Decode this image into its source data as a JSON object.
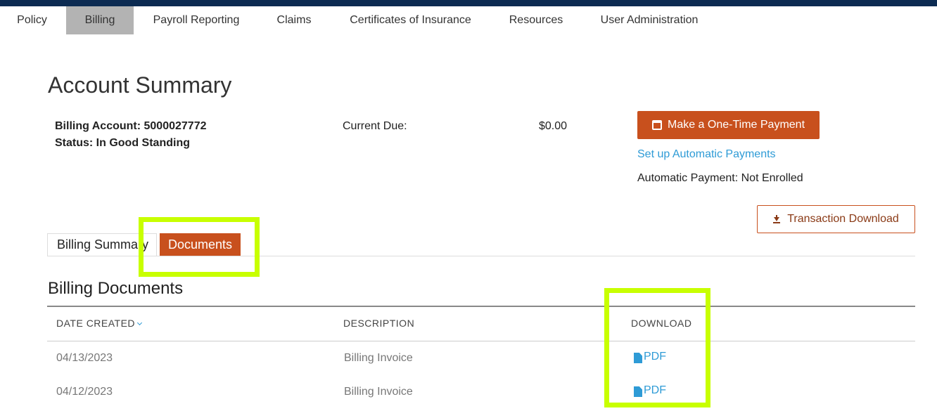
{
  "nav": {
    "items": [
      "Policy",
      "Billing",
      "Payroll Reporting",
      "Claims",
      "Certificates of Insurance",
      "Resources",
      "User Administration"
    ],
    "active": "Billing"
  },
  "page_title": "Account Summary",
  "account": {
    "billing_account": "Billing Account: 5000027772",
    "status": "Status: In Good Standing",
    "current_due_label": "Current Due:",
    "current_due_value": "$0.00"
  },
  "actions": {
    "one_time_payment": "Make a One-Time Payment",
    "setup_auto": "Set up Automatic Payments",
    "auto_status": "Automatic Payment: Not Enrolled",
    "transaction_download": "Transaction Download"
  },
  "tabs": [
    "Billing Summary",
    "Documents"
  ],
  "active_tab": "Documents",
  "documents": {
    "title": "Billing Documents",
    "headers": {
      "date": "DATE CREATED",
      "description": "DESCRIPTION",
      "download": "DOWNLOAD"
    },
    "rows": [
      {
        "date": "04/13/2023",
        "description": "Billing Invoice",
        "download": "PDF"
      },
      {
        "date": "04/12/2023",
        "description": "Billing Invoice",
        "download": "PDF"
      }
    ]
  },
  "colors": {
    "brand_navy": "#0c2b52",
    "accent_orange": "#c8501d",
    "link_blue": "#2e9bd6",
    "highlight": "#c8ff00"
  },
  "icons": {
    "payment": "calendar-icon",
    "download": "download-icon",
    "pdf": "document-icon"
  }
}
